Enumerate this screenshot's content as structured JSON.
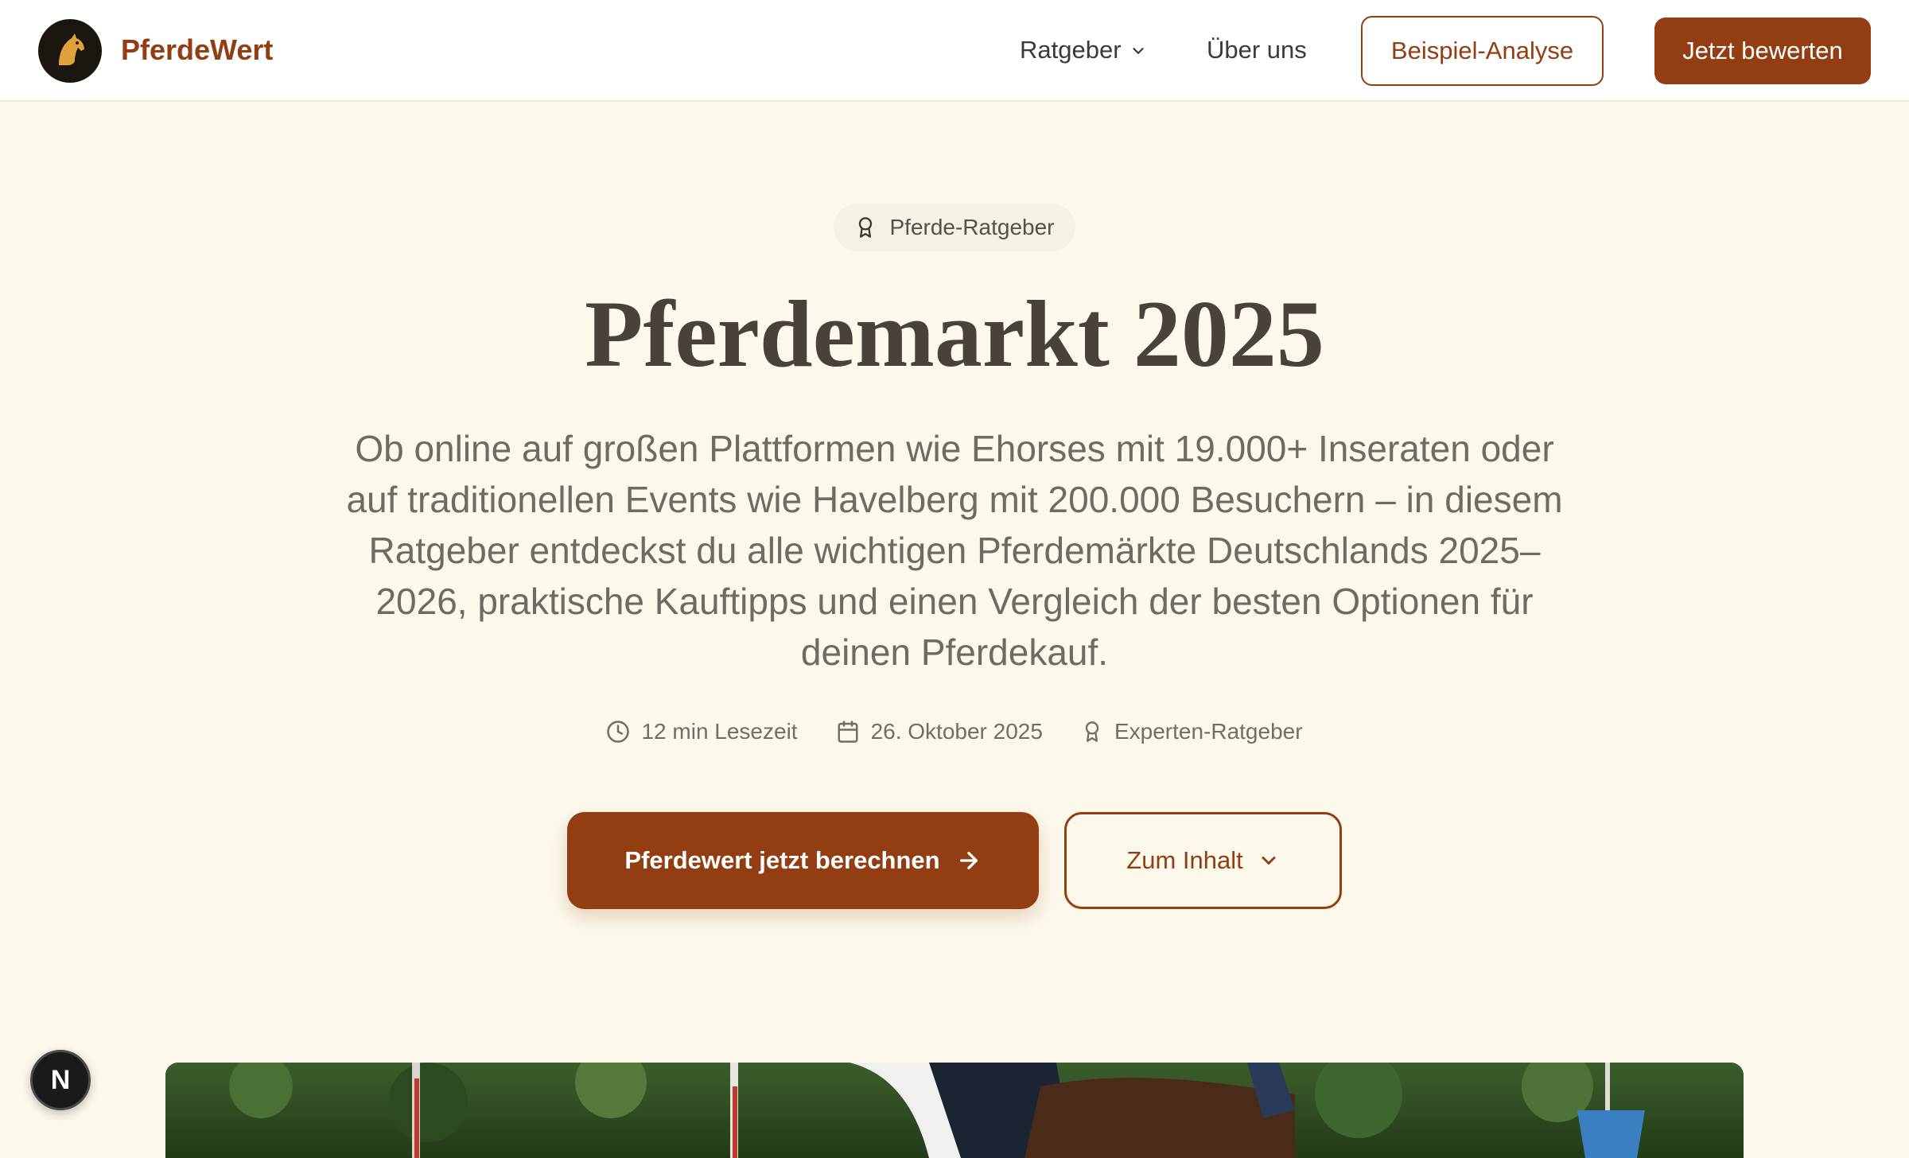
{
  "header": {
    "brand": "PferdeWert",
    "nav": {
      "ratgeber": "Ratgeber",
      "about": "Über uns"
    },
    "buttons": {
      "example": "Beispiel-Analyse",
      "rate": "Jetzt bewerten"
    }
  },
  "hero": {
    "badge": "Pferde-Ratgeber",
    "title": "Pferdemarkt 2025",
    "description": "Ob online auf großen Plattformen wie Ehorses mit 19.000+ Inseraten oder auf traditionellen Events wie Havelberg mit 200.000 Besuchern – in diesem Ratgeber entdeckst du alle wichtigen Pferdemärkte Deutschlands 2025–2026, praktische Kauftipps und einen Vergleich der besten Optionen für deinen Pferdekauf.",
    "meta": {
      "reading_time": "12 min Lesezeit",
      "date": "26. Oktober 2025",
      "category": "Experten-Ratgeber"
    },
    "cta_primary": "Pferdewert jetzt berechnen",
    "cta_secondary": "Zum Inhalt"
  },
  "dev_badge": "N",
  "colors": {
    "brand": "#923e12",
    "background": "#fcf9ec",
    "title": "#48423a"
  }
}
